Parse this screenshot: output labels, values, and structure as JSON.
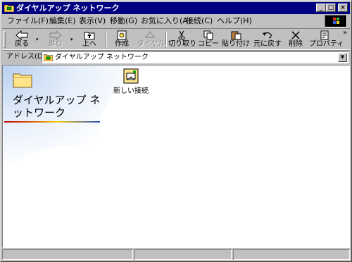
{
  "window": {
    "title": "ダイヤルアップ ネットワーク"
  },
  "title_buttons": {
    "minimize": "_",
    "maximize": "□",
    "close": "×"
  },
  "menu": [
    {
      "label": "ファイル(F)"
    },
    {
      "label": "編集(E)"
    },
    {
      "label": "表示(V)"
    },
    {
      "label": "移動(G)"
    },
    {
      "label": "お気に入り(A)"
    },
    {
      "label": "接続(C)"
    },
    {
      "label": "ヘルプ(H)"
    }
  ],
  "toolbar": {
    "back": "戻る",
    "forward": "進む",
    "up": "上へ",
    "create": "作成",
    "dial": "ダイヤル",
    "cut": "切り取り",
    "copy": "コピー",
    "paste": "貼り付け",
    "undo": "元に戻す",
    "delete": "削除",
    "properties": "プロパティ",
    "overflow": "»",
    "dropdown_glyph": "▾"
  },
  "address": {
    "label": "アドレス(D)",
    "value": "ダイヤルアップ ネットワーク",
    "dropdown_glyph": "▼"
  },
  "content": {
    "folder_title": "ダイヤルアップ ネットワーク",
    "items": [
      {
        "label": "新しい接続"
      }
    ]
  },
  "colors": {
    "titlebar": "#000080",
    "face": "#c0c0c0"
  },
  "icons": {
    "title": "dialup-folder-icon",
    "back": "back-arrow-icon",
    "forward": "forward-arrow-icon",
    "up": "up-folder-icon",
    "create": "create-icon",
    "dial": "dial-icon",
    "cut": "scissors-icon",
    "copy": "copy-icon",
    "paste": "paste-icon",
    "undo": "undo-icon",
    "delete": "delete-x-icon",
    "properties": "properties-icon",
    "folder": "folder-icon",
    "new_connection": "new-connection-icon"
  }
}
